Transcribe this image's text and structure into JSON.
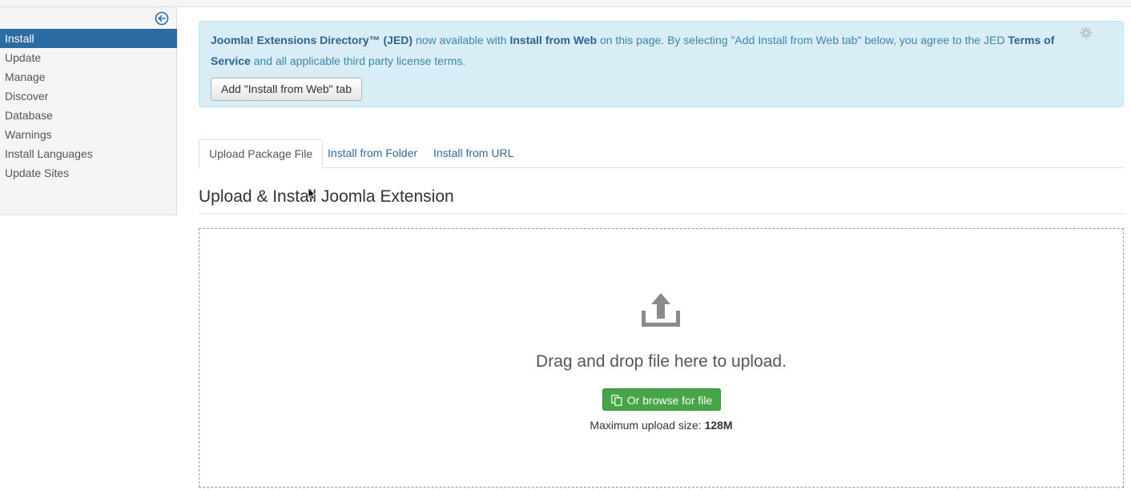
{
  "sidebar": {
    "toggle_icon": "circle-arrow-left-icon",
    "items": [
      {
        "label": "Install",
        "active": true
      },
      {
        "label": "Update"
      },
      {
        "label": "Manage"
      },
      {
        "label": "Discover"
      },
      {
        "label": "Database"
      },
      {
        "label": "Warnings"
      },
      {
        "label": "Install Languages"
      },
      {
        "label": "Update Sites"
      }
    ]
  },
  "alert": {
    "part1_strong": "Joomla! Extensions Directory™ (JED)",
    "part2": " now available with ",
    "part3_strong": "Install from Web",
    "part4": " on this page. By selecting \"Add Install from Web tab\" below, you agree to the JED ",
    "part5_strong": "Terms of Service",
    "part6": " and all applicable third party license terms.",
    "button_label": "Add \"Install from Web\" tab",
    "settings_icon": "gear-icon"
  },
  "tabs": [
    {
      "label": "Upload Package File",
      "active": true
    },
    {
      "label": "Install from Folder"
    },
    {
      "label": "Install from URL"
    }
  ],
  "section_title": "Upload & Install Joomla Extension",
  "upload": {
    "icon": "upload-icon",
    "drop_text": "Drag and drop file here to upload.",
    "browse_label": "Or browse for file",
    "max_label": "Maximum upload size: ",
    "max_value": "128M"
  },
  "colors": {
    "sidebar_active": "#2d6ca2",
    "alert_bg": "#d9edf7",
    "link": "#2a69b8",
    "success": "#46a546"
  }
}
